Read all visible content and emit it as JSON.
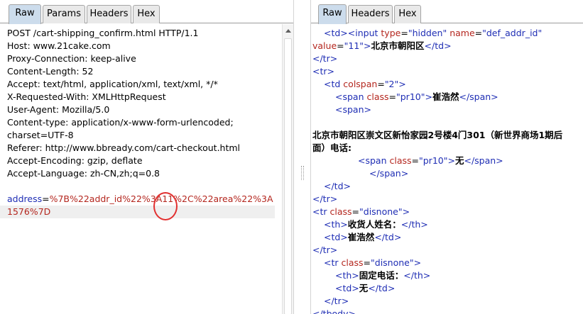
{
  "left": {
    "tabs": [
      {
        "label": "Raw",
        "active": true
      },
      {
        "label": "Params",
        "active": false
      },
      {
        "label": "Headers",
        "active": false
      },
      {
        "label": "Hex",
        "active": false
      }
    ],
    "request_lines": [
      "POST /cart-shipping_confirm.html HTTP/1.1",
      "Host: www.21cake.com",
      "Proxy-Connection: keep-alive",
      "Content-Length: 52",
      "Accept: text/html, application/xml, text/xml, */*",
      "X-Requested-With: XMLHttpRequest",
      "User-Agent: Mozilla/5.0",
      "Content-type: application/x-www-form-urlencoded;",
      "charset=UTF-8",
      "Referer: http://www.bbready.com/cart-checkout.html",
      "Accept-Encoding: gzip, deflate",
      "Accept-Language: zh-CN,zh;q=0.8",
      ""
    ],
    "body": {
      "param_name": "address",
      "eq": "=",
      "line1_value": "%7B%22addr_id%22%3A11%2C%22area%22%3A",
      "line2_value": "1576%7D"
    }
  },
  "right": {
    "tabs": [
      {
        "label": "Raw",
        "active": true
      },
      {
        "label": "Headers",
        "active": false
      },
      {
        "label": "Hex",
        "active": false
      }
    ],
    "lines": [
      {
        "indent": 1,
        "parts": [
          [
            "tag",
            "<td>"
          ],
          [
            "tag",
            "<input "
          ],
          [
            "attr",
            "type"
          ],
          [
            "plain",
            "="
          ],
          [
            "tag",
            "\"hidden\" "
          ],
          [
            "attr",
            "name"
          ],
          [
            "plain",
            "="
          ],
          [
            "tag",
            "\"def_addr_id\""
          ]
        ]
      },
      {
        "indent": 0,
        "parts": [
          [
            "attr",
            "value"
          ],
          [
            "plain",
            "="
          ],
          [
            "tag",
            "\"11\">"
          ],
          [
            "txt",
            "北京市朝阳区"
          ],
          [
            "tag",
            "</td>"
          ]
        ]
      },
      {
        "indent": 0,
        "parts": [
          [
            "tag",
            "</tr>"
          ]
        ]
      },
      {
        "indent": 0,
        "parts": [
          [
            "tag",
            "<tr>"
          ]
        ]
      },
      {
        "indent": 1,
        "parts": [
          [
            "tag",
            "<td "
          ],
          [
            "attr",
            "colspan"
          ],
          [
            "plain",
            "="
          ],
          [
            "tag",
            "\"2\">"
          ]
        ]
      },
      {
        "indent": 2,
        "parts": [
          [
            "tag",
            "<span "
          ],
          [
            "attr",
            "class"
          ],
          [
            "plain",
            "="
          ],
          [
            "tag",
            "\"pr10\">"
          ],
          [
            "txt",
            "崔浩然"
          ],
          [
            "tag",
            "</span>"
          ]
        ]
      },
      {
        "indent": 2,
        "parts": [
          [
            "tag",
            "<span>"
          ]
        ]
      },
      {
        "indent": 0,
        "parts": []
      },
      {
        "indent": 0,
        "parts": [
          [
            "txt",
            "北京市朝阳区崇文区新怡家园2号楼4门301（新世界商场1期后"
          ]
        ]
      },
      {
        "indent": 0,
        "parts": [
          [
            "txt",
            "面）电话:"
          ]
        ]
      },
      {
        "indent": 4,
        "parts": [
          [
            "tag",
            "<span "
          ],
          [
            "attr",
            "class"
          ],
          [
            "plain",
            "="
          ],
          [
            "tag",
            "\"pr10\">"
          ],
          [
            "txt",
            "无"
          ],
          [
            "tag",
            "</span>"
          ]
        ]
      },
      {
        "indent": 5,
        "parts": [
          [
            "tag",
            "</span>"
          ]
        ]
      },
      {
        "indent": 1,
        "parts": [
          [
            "tag",
            "</td>"
          ]
        ]
      },
      {
        "indent": 0,
        "parts": [
          [
            "tag",
            "</tr>"
          ]
        ]
      },
      {
        "indent": 0,
        "parts": [
          [
            "tag",
            "<tr "
          ],
          [
            "attr",
            "class"
          ],
          [
            "plain",
            "="
          ],
          [
            "tag",
            "\"disnone\">"
          ]
        ]
      },
      {
        "indent": 1,
        "parts": [
          [
            "tag",
            "<th>"
          ],
          [
            "txt",
            "收货人姓名："
          ],
          [
            "tag",
            "</th>"
          ]
        ]
      },
      {
        "indent": 1,
        "parts": [
          [
            "tag",
            "<td>"
          ],
          [
            "txt",
            "崔浩然"
          ],
          [
            "tag",
            "</td>"
          ]
        ]
      },
      {
        "indent": 0,
        "parts": [
          [
            "tag",
            "</tr>"
          ]
        ]
      },
      {
        "indent": 1,
        "parts": [
          [
            "tag",
            "<tr "
          ],
          [
            "attr",
            "class"
          ],
          [
            "plain",
            "="
          ],
          [
            "tag",
            "\"disnone\">"
          ]
        ]
      },
      {
        "indent": 2,
        "parts": [
          [
            "tag",
            "<th>"
          ],
          [
            "txt",
            "固定电话："
          ],
          [
            "tag",
            "</th>"
          ]
        ]
      },
      {
        "indent": 2,
        "parts": [
          [
            "tag",
            "<td>"
          ],
          [
            "txt",
            "无"
          ],
          [
            "tag",
            "</td>"
          ]
        ]
      },
      {
        "indent": 1,
        "parts": [
          [
            "tag",
            "</tr>"
          ]
        ]
      },
      {
        "indent": 0,
        "parts": [
          [
            "tag",
            "</tbody>"
          ]
        ]
      }
    ]
  },
  "colors": {
    "tag": "#1e2db4",
    "attr": "#b4261e",
    "active_tab": "#ccdcec",
    "inactive_tab": "#e9e9e9",
    "annotation_circle": "#e23030"
  }
}
